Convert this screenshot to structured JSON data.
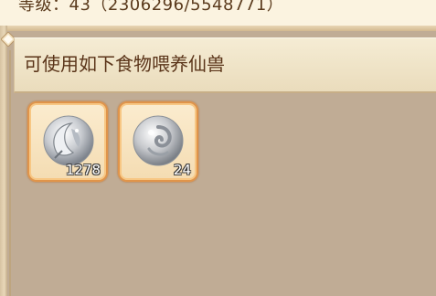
{
  "top": {
    "level_text": "等级：43（2306296/5548771）"
  },
  "header": {
    "title": "可使用如下食物喂养仙兽"
  },
  "items": [
    {
      "icon": "silver-moon-orb-icon",
      "count": "1278"
    },
    {
      "icon": "silver-swirl-orb-icon",
      "count": "24"
    }
  ],
  "colors": {
    "panel_bg": "#c0ac95",
    "header_bg": "#f2e7cc",
    "slot_border": "#e0944a"
  }
}
